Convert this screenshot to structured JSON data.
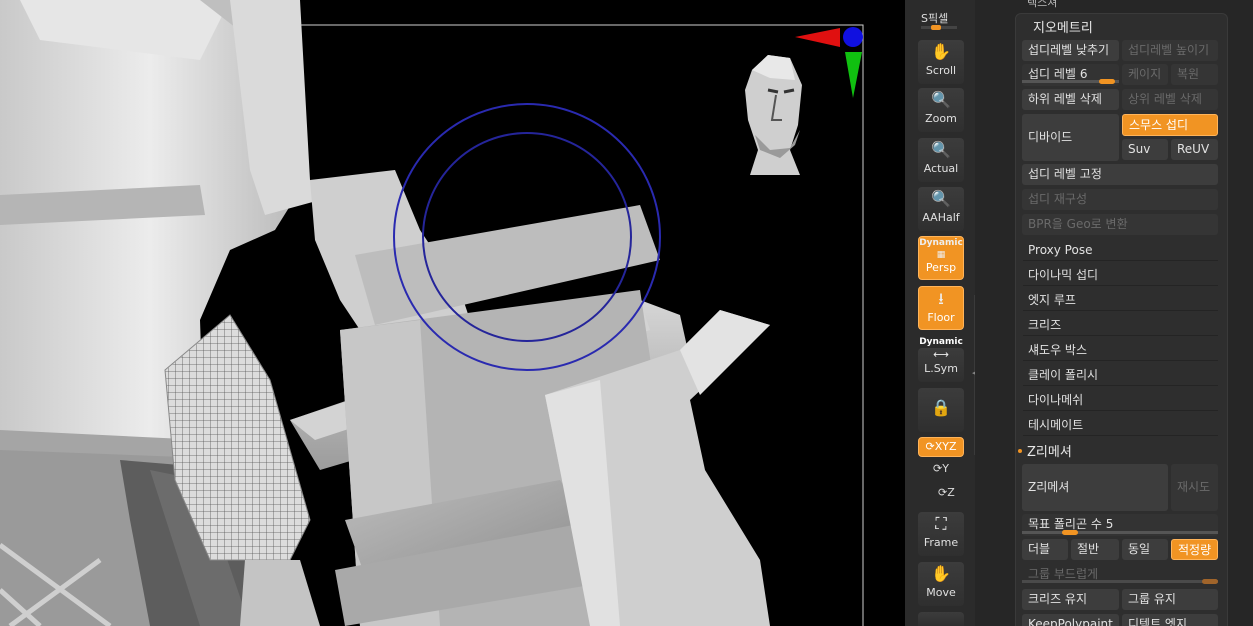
{
  "viewport": {
    "canvas_name": "3d-viewport"
  },
  "shelf": {
    "spix_label": "S픽셀",
    "spix_value": 0.4,
    "buttons": [
      {
        "name": "scroll-button",
        "label": "Scroll",
        "icon": "hand-move-icon",
        "active": false
      },
      {
        "name": "zoom-button",
        "label": "Zoom",
        "icon": "magnifier-icon",
        "active": false
      },
      {
        "name": "actual-button",
        "label": "Actual",
        "icon": "magnifier-actual-icon",
        "active": false
      },
      {
        "name": "aahalf-button",
        "label": "AAHalf",
        "icon": "magnifier-half-icon",
        "active": false
      },
      {
        "name": "persp-button",
        "label": "Persp",
        "icon": "perspective-grid-icon",
        "active": true
      },
      {
        "name": "floor-button",
        "label": "Floor",
        "icon": "floor-icon",
        "active": true
      },
      {
        "name": "lsym-button",
        "label": "L.Sym",
        "icon": "symmetry-arrows-icon",
        "active": false
      },
      {
        "name": "lock-button",
        "label": "",
        "icon": "lock-icon",
        "active": false
      },
      {
        "name": "frame-button",
        "label": "Frame",
        "icon": "frame-icon",
        "active": false
      },
      {
        "name": "move-button",
        "label": "Move",
        "icon": "hand-move-icon",
        "active": false
      }
    ],
    "dynamic_label_1": "Dynamic",
    "dynamic_label_2": "Dynamic",
    "xyz_label": "XYZ",
    "rot_y_label": "Y",
    "rot_z_label": "Z"
  },
  "panel": {
    "top_remnant": "텍스쳐",
    "geometry_title": "지오메트리",
    "lower_subdiv": "섭디레벨 낮추기",
    "higher_subdiv": "섭디레벨 높이기",
    "subdiv_level_label": "섭디 레벨",
    "subdiv_level_value": "6",
    "cage": "케이지",
    "restore": "복원",
    "del_lower": "하위 레벨 삭제",
    "del_higher": "상위 레벨 삭제",
    "divide": "디바이드",
    "smooth_subdiv": "스무스 섭디",
    "suv": "Suv",
    "reuv": "ReUV",
    "freeze_subdiv": "섭디 레벨 고정",
    "reconstruct_subdiv": "섭디 재구성",
    "bpr_to_geo": "BPR을 Geo로 변환",
    "menu_items": [
      "Proxy Pose",
      "다이나믹 섭디",
      "엣지 루프",
      "크리즈",
      "섀도우 박스",
      "클레이 폴리시",
      "다이나메쉬",
      "테시메이트"
    ],
    "zremesher_title": "Z리메셔",
    "zremesher": "Z리메셔",
    "retry": "재시도",
    "target_poly_label": "목표 폴리곤 수",
    "target_poly_value": "5",
    "target_poly_fraction": 0.2,
    "double": "더블",
    "half": "절반",
    "same": "동일",
    "adaptive": "적정량",
    "group_smooth": "그룹 부드럽게",
    "keep_creases": "크리즈 유지",
    "keep_groups": "그룹 유지",
    "keep_polypaint": "KeepPolypaint",
    "detect_edges": "디텍트 엣지"
  },
  "colors": {
    "accent": "#f19423",
    "gizmo_x": "#e01010",
    "gizmo_y": "#10c010",
    "gizmo_z": "#1010e0",
    "brush_circle": "#2a2ab0"
  }
}
